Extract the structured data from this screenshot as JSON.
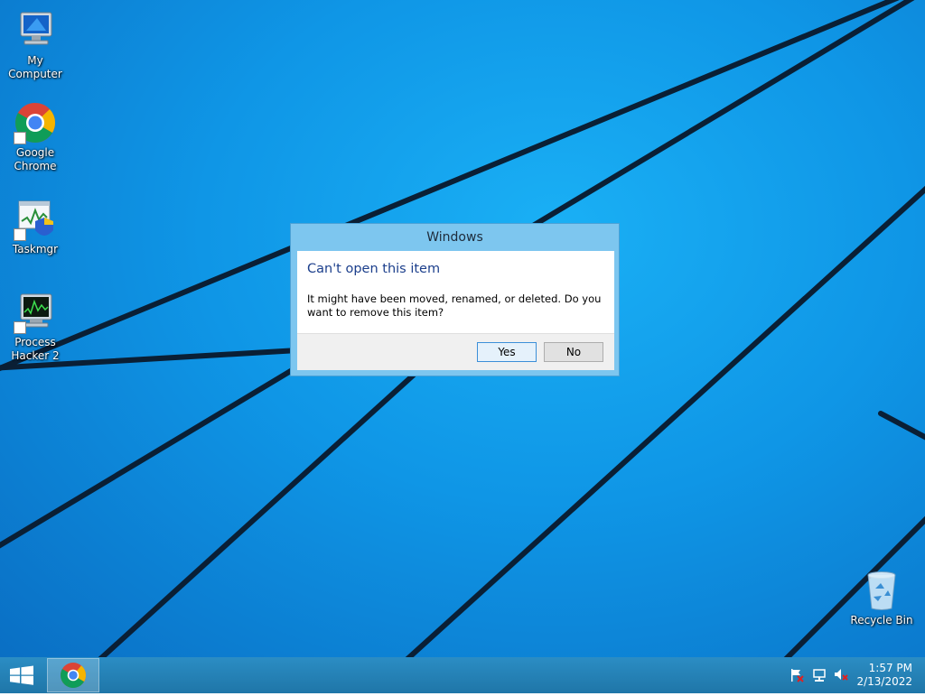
{
  "desktop": {
    "icons": [
      {
        "label_line1": "My Computer",
        "label_line2": ""
      },
      {
        "label_line1": "Google",
        "label_line2": "Chrome"
      },
      {
        "label_line1": "Taskmgr",
        "label_line2": ""
      },
      {
        "label_line1": "Process",
        "label_line2": "Hacker 2"
      },
      {
        "label_line1": "Recycle Bin",
        "label_line2": ""
      }
    ]
  },
  "dialog": {
    "title": "Windows",
    "heading": "Can't open this item",
    "message": "It might have been moved, renamed, or deleted. Do you want to remove this item?",
    "yes_label": "Yes",
    "no_label": "No"
  },
  "taskbar": {
    "time": "1:57 PM",
    "date": "2/13/2022",
    "pinned": [
      "chrome-icon"
    ],
    "tray": [
      "action-center-flag-icon",
      "network-icon",
      "speaker-muted-icon"
    ]
  },
  "colors": {
    "wallpaper": "#1a9ee8",
    "taskbar": "#2784b8",
    "dialog_frame": "#7dc6ef",
    "heading_text": "#1c3f8c"
  }
}
